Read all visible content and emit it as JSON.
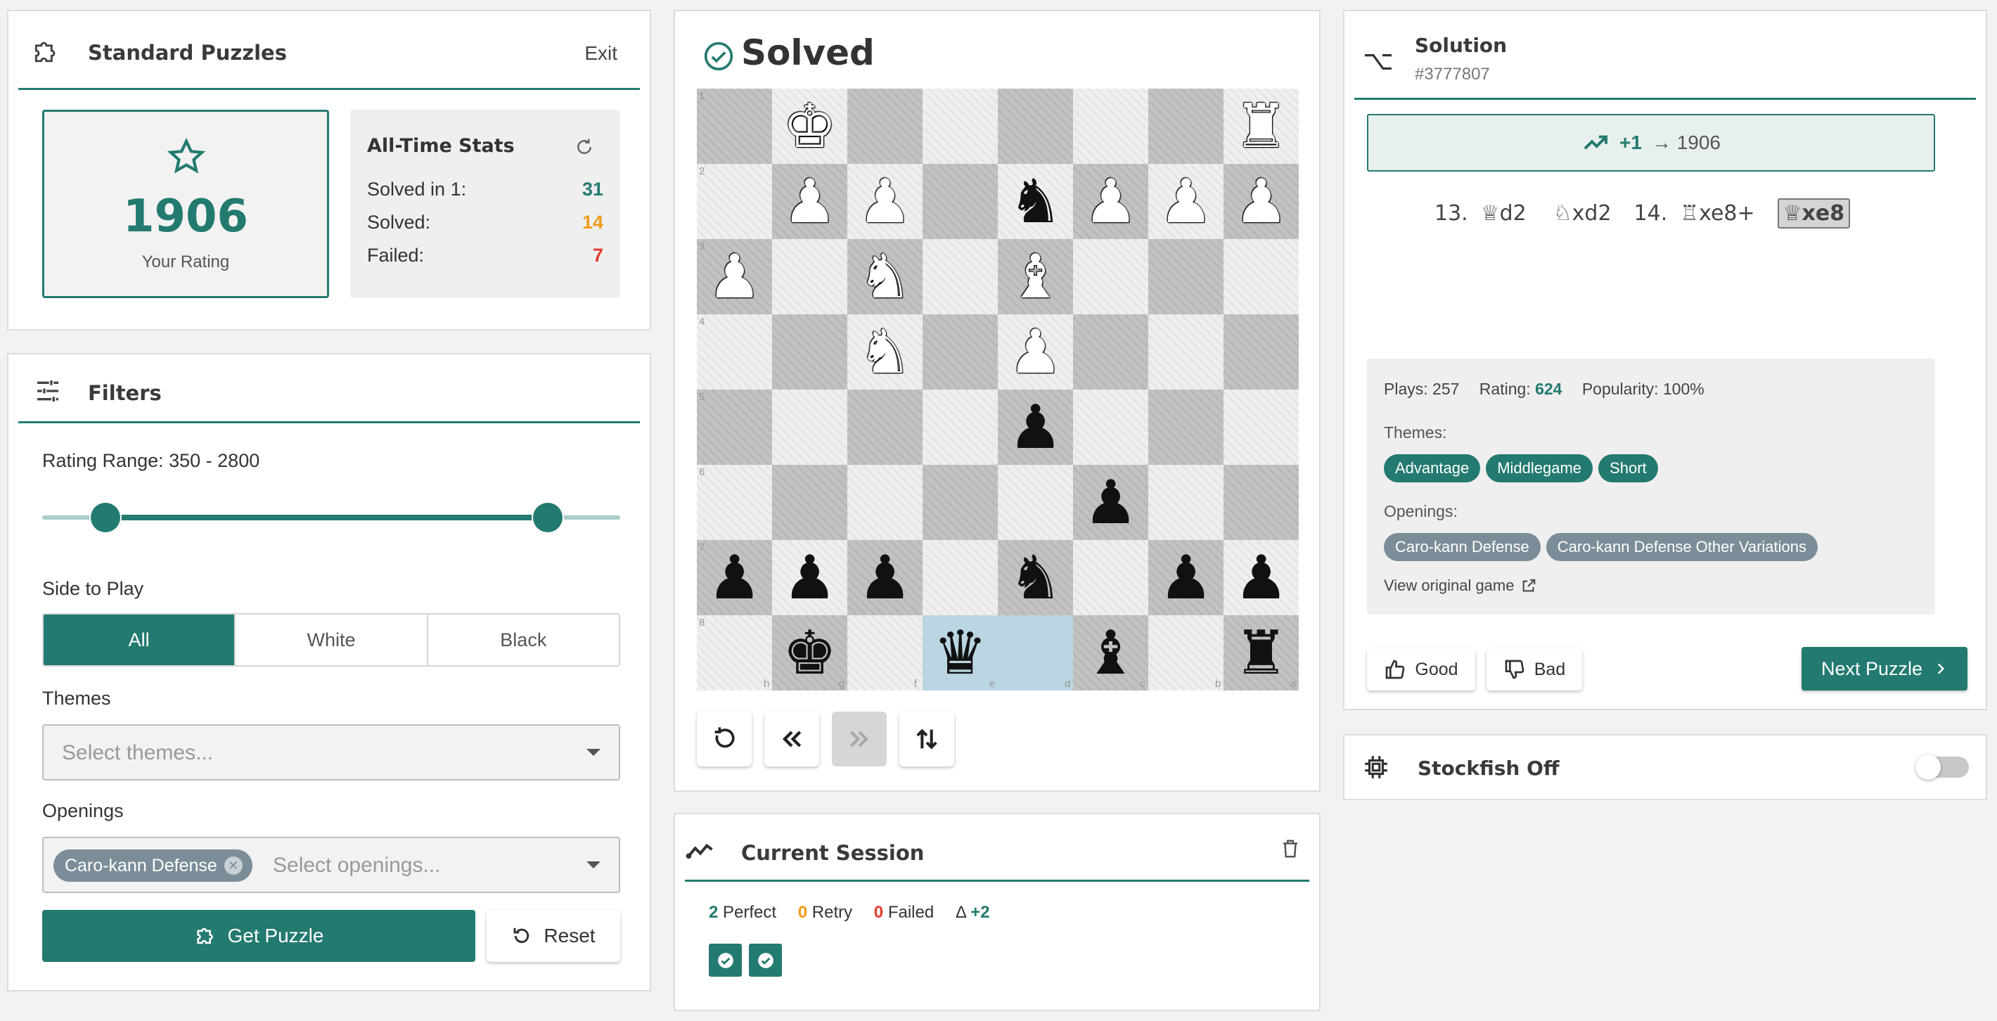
{
  "header_panel": {
    "title": "Standard Puzzles",
    "exit_label": "Exit"
  },
  "rating": {
    "value": "1906",
    "label": "Your Rating"
  },
  "stats": {
    "title": "All-Time Stats",
    "rows": [
      {
        "label": "Solved in 1:",
        "value": "31",
        "color": "#237a70"
      },
      {
        "label": "Solved:",
        "value": "14",
        "color": "#f09a18"
      },
      {
        "label": "Failed:",
        "value": "7",
        "color": "#e23b2e"
      }
    ]
  },
  "filters": {
    "title": "Filters",
    "rating_range_label": "Rating Range: 350 - 2800",
    "range": {
      "min": 350,
      "max": 2800,
      "track_min": 0,
      "track_max": 3200
    },
    "side_label": "Side to Play",
    "sides": [
      "All",
      "White",
      "Black"
    ],
    "side_selected": "All",
    "themes_label": "Themes",
    "themes_placeholder": "Select themes...",
    "openings_label": "Openings",
    "openings_chip": "Caro-kann Defense",
    "openings_placeholder": "Select openings...",
    "get_puzzle_label": "Get Puzzle",
    "reset_label": "Reset"
  },
  "status": {
    "label": "Solved"
  },
  "board": {
    "ranks": [
      "1",
      "2",
      "3",
      "4",
      "5",
      "6",
      "7",
      "8"
    ],
    "files_bottom": [
      "h",
      "g",
      "f",
      "e",
      "d",
      "c",
      "b",
      "a"
    ],
    "rows": [
      [
        "",
        "wK",
        "",
        "",
        "",
        "",
        "",
        "wR"
      ],
      [
        "",
        "wP",
        "wP",
        "",
        "bN",
        "wP",
        "wP",
        "wP"
      ],
      [
        "wP",
        "",
        "wN",
        "",
        "wB",
        "",
        "",
        ""
      ],
      [
        "",
        "",
        "wN",
        "",
        "wP",
        "",
        "",
        ""
      ],
      [
        "",
        "",
        "",
        "",
        "bP",
        "",
        "",
        ""
      ],
      [
        "",
        "",
        "",
        "",
        "",
        "bP",
        "",
        ""
      ],
      [
        "bP",
        "bP",
        "bP",
        "",
        "bN",
        "",
        "bP",
        "bP"
      ],
      [
        "",
        "bK",
        "",
        "bQ",
        "",
        "bB",
        "",
        "bR"
      ]
    ],
    "highlight": [
      [
        7,
        3
      ],
      [
        7,
        4
      ]
    ]
  },
  "session": {
    "title": "Current Session",
    "perfect_count": "2",
    "perfect_label": "Perfect",
    "retry_count": "0",
    "retry_label": "Retry",
    "failed_count": "0",
    "failed_label": "Failed",
    "delta_symbol": "Δ",
    "delta_value": "+2",
    "results": [
      "solved",
      "solved"
    ]
  },
  "solution": {
    "title": "Solution",
    "id": "#3777807",
    "rating_change": "+1",
    "rating_new": "→ 1906",
    "moves": [
      {
        "num": "13.",
        "san": "♕d2",
        "active": false
      },
      {
        "num": "",
        "san": "♘xd2",
        "active": false
      },
      {
        "num": "14.",
        "san": "♖xe8+",
        "active": false
      },
      {
        "num": "",
        "san": "♕xe8",
        "active": true
      }
    ],
    "plays_label": "Plays:",
    "plays_value": "257",
    "rating_label": "Rating:",
    "rating_value": "624",
    "popularity_label": "Popularity:",
    "popularity_value": "100%",
    "themes_label": "Themes:",
    "themes": [
      "Advantage",
      "Middlegame",
      "Short"
    ],
    "openings_label": "Openings:",
    "openings": [
      "Caro-kann Defense",
      "Caro-kann Defense Other Variations"
    ],
    "view_game_label": "View original game",
    "good_label": "Good",
    "bad_label": "Bad",
    "next_label": "Next Puzzle"
  },
  "engine": {
    "label": "Stockfish Off",
    "enabled": false
  },
  "colors": {
    "accent": "#237a70",
    "retry": "#f09a18",
    "failed": "#e23b2e",
    "chip_gray": "#7b8d98"
  }
}
